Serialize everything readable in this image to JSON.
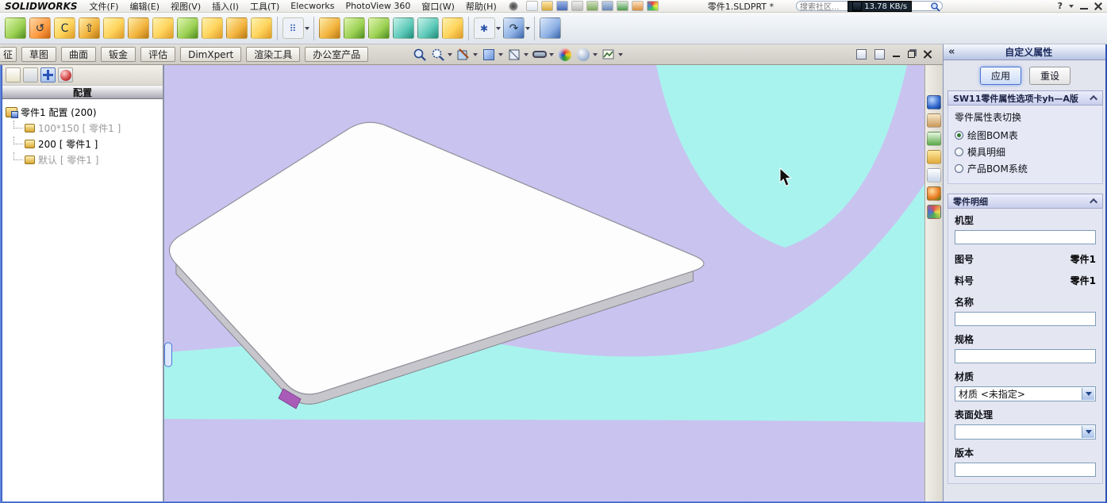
{
  "menubar": {
    "logo": "SOLIDWORKS",
    "menus": [
      "文件(F)",
      "编辑(E)",
      "视图(V)",
      "插入(I)",
      "工具(T)",
      "Elecworks",
      "PhotoView 360",
      "窗口(W)",
      "帮助(H)"
    ],
    "doc_title": "零件1.SLDPRT *",
    "search_placeholder": "搜索社区...",
    "net_speed": "13.78 KB/s",
    "help_label": "?"
  },
  "tabrow": {
    "tabs": [
      "征",
      "草图",
      "曲面",
      "钣金",
      "评估",
      "DimXpert",
      "渲染工具",
      "办公室产品"
    ]
  },
  "left_panel": {
    "header": "配置",
    "tree": [
      {
        "label": "零件1 配置  (200)"
      },
      {
        "label": "100*150 [ 零件1 ]"
      },
      {
        "label": "200 [ 零件1 ]"
      },
      {
        "label": "默认 [ 零件1 ]"
      }
    ]
  },
  "right_panel": {
    "collapse": "«",
    "title": "自定义属性",
    "apply": "应用",
    "reset": "重设",
    "template_title": "SW11零件属性选项卡yh—A版",
    "switch_label": "零件属性表切换",
    "radios": [
      {
        "label": "绘图BOM表",
        "selected": true
      },
      {
        "label": "模具明细",
        "selected": false
      },
      {
        "label": "产品BOM系统",
        "selected": false
      }
    ],
    "detail_title": "零件明细",
    "fields": {
      "jixing_label": "机型",
      "tuhao_label": "图号",
      "tuhao_value": "零件1",
      "liaohao_label": "料号",
      "liaohao_value": "零件1",
      "mingcheng_label": "名称",
      "guige_label": "规格",
      "caizhi_label": "材质",
      "caizhi_value": "材质 <未指定>",
      "biaomian_label": "表面处理",
      "banben_label": "版本"
    }
  },
  "colors": {
    "viewport_bg": "#c9c3ef",
    "highlight_cyan": "#a9f3ee",
    "plate_top": "#fdfdfd",
    "plate_side": "#c6c6cc",
    "selection_magenta": "#a85cb8",
    "accent_blue": "#2d54b4"
  }
}
